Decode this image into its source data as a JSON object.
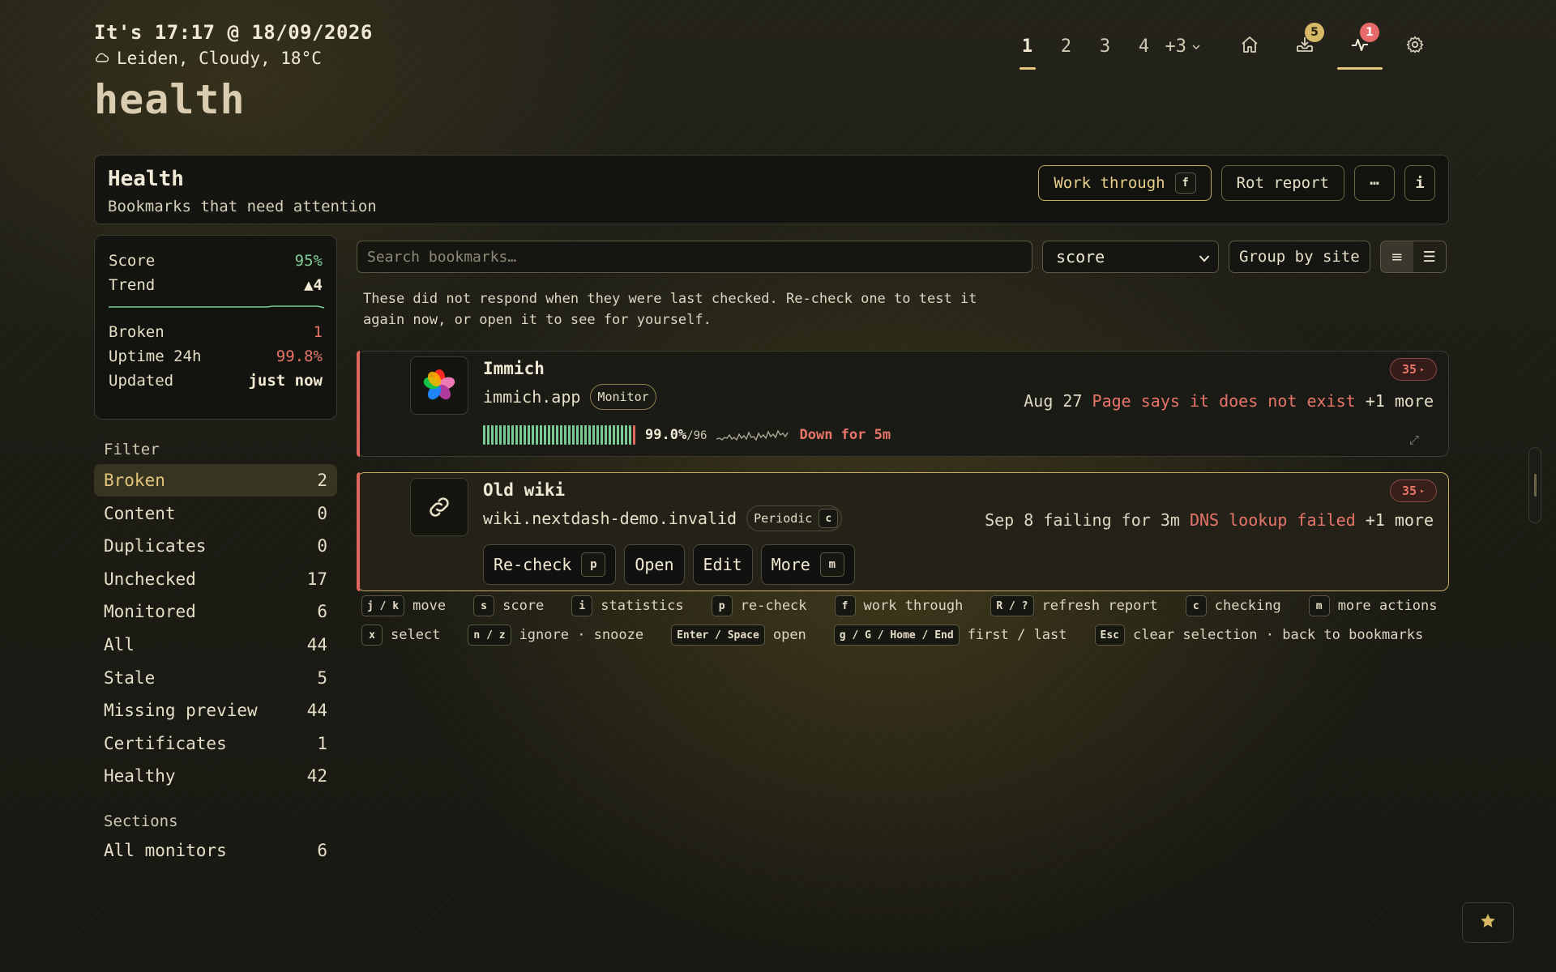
{
  "header": {
    "clock": "It's 17:17 @ 18/09/2026",
    "weather": "Leiden, Cloudy, 18°C",
    "page_title": "health"
  },
  "topnav": {
    "pages": [
      "1",
      "2",
      "3",
      "4"
    ],
    "more_label": "+3",
    "icons": [
      {
        "name": "home-icon"
      },
      {
        "name": "inbox-icon",
        "badge": "5"
      },
      {
        "name": "pulse-icon",
        "badge": "1"
      },
      {
        "name": "gear-icon"
      }
    ]
  },
  "panel": {
    "title": "Health",
    "subtitle": "Bookmarks that need attention",
    "work_through_label": "Work through",
    "work_through_key": "f",
    "rot_report_label": "Rot report",
    "more_label": "⋯",
    "info_label": "i"
  },
  "stats": {
    "score_label": "Score",
    "score_value": "95%",
    "trend_label": "Trend",
    "trend_value": "▲4",
    "broken_label": "Broken",
    "broken_value": "1",
    "uptime_label": "Uptime 24h",
    "uptime_value": "99.8%",
    "updated_label": "Updated",
    "updated_value": "just now"
  },
  "filter": {
    "title": "Filter",
    "items": [
      {
        "label": "Broken",
        "count": "2"
      },
      {
        "label": "Content",
        "count": "0"
      },
      {
        "label": "Duplicates",
        "count": "0"
      },
      {
        "label": "Unchecked",
        "count": "17"
      },
      {
        "label": "Monitored",
        "count": "6"
      },
      {
        "label": "All",
        "count": "44"
      },
      {
        "label": "Stale",
        "count": "5"
      },
      {
        "label": "Missing preview",
        "count": "44"
      },
      {
        "label": "Certificates",
        "count": "1"
      },
      {
        "label": "Healthy",
        "count": "42"
      }
    ]
  },
  "sections": {
    "title": "Sections",
    "items": [
      {
        "label": "All monitors",
        "count": "6"
      }
    ]
  },
  "toolbar": {
    "search_placeholder": "Search bookmarks…",
    "sort_value": "score",
    "group_label": "Group by site"
  },
  "info_text": "These did not respond when they were last checked. Re-check one to test it again now, or open it to see for yourself.",
  "cards": [
    {
      "name": "Immich",
      "host": "immich.app",
      "tag": "Monitor",
      "score": "35",
      "status_date": "Aug 27",
      "status_error": "Page says it does not exist",
      "status_more": "+1 more",
      "uptime_pct": "99.0%",
      "uptime_checks": "/96",
      "down_text": "Down for 5m"
    },
    {
      "name": "Old wiki",
      "host": "wiki.nextdash-demo.invalid",
      "tag": "Periodic",
      "tag_key": "c",
      "score": "35",
      "status_date": "Sep 8 failing for 3m",
      "status_error": "DNS lookup failed",
      "status_more": "+1 more",
      "actions": {
        "recheck": "Re-check",
        "recheck_key": "p",
        "open": "Open",
        "edit": "Edit",
        "more": "More",
        "more_key": "m"
      }
    }
  ],
  "shortcuts": {
    "row1": [
      {
        "key": "j / k",
        "label": "move"
      },
      {
        "key": "s",
        "label": "score"
      },
      {
        "key": "i",
        "label": "statistics"
      },
      {
        "key": "p",
        "label": "re-check"
      },
      {
        "key": "f",
        "label": "work through"
      },
      {
        "key": "R / ?",
        "label": "refresh report"
      },
      {
        "key": "c",
        "label": "checking"
      },
      {
        "key": "m",
        "label": "more actions"
      }
    ],
    "row2": [
      {
        "key": "x",
        "label": "select"
      },
      {
        "key": "n / z",
        "label": "ignore · snooze"
      },
      {
        "key": "Enter / Space",
        "label": "open"
      },
      {
        "key": "g / G / Home / End",
        "label": "first / last"
      },
      {
        "key": "Esc",
        "label": "clear selection · back to bookmarks"
      }
    ]
  },
  "colors": {
    "accent": "#e3c57c",
    "ok": "#79c995",
    "error": "#e8756a"
  }
}
